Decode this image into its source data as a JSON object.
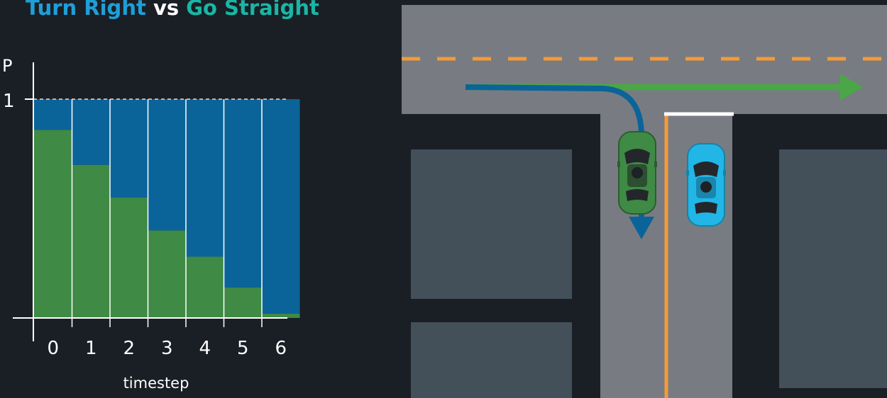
{
  "title": {
    "turn_right": "Turn Right",
    "vs": "vs",
    "go_straight": "Go Straight"
  },
  "colors": {
    "turn_right": "#0b6499",
    "go_straight": "#3f8a45",
    "title_turn_right": "#1f9fd8",
    "title_go_straight": "#19b7a4",
    "background": "#1a1f26",
    "road": "#787c82",
    "block": "#434f59",
    "center_line": "#f59a35",
    "stop_line": "#ffffff",
    "green_car": "#3f8a45",
    "blue_car": "#21b6e6"
  },
  "chart_data": {
    "type": "bar",
    "stacked": true,
    "xlabel": "timestep",
    "ylabel": "P",
    "categories": [
      "0",
      "1",
      "2",
      "3",
      "4",
      "5",
      "6"
    ],
    "yticks": [
      {
        "value": 1,
        "label": "1"
      }
    ],
    "ylim": [
      0,
      1
    ],
    "grid": false,
    "series": [
      {
        "key": "go_straight",
        "values": [
          0.86,
          0.7,
          0.55,
          0.4,
          0.28,
          0.14,
          0.02
        ]
      },
      {
        "key": "turn_right",
        "values": [
          0.14,
          0.3,
          0.45,
          0.6,
          0.72,
          0.86,
          0.98
        ]
      }
    ]
  },
  "scene": {
    "road_orientation": "T-intersection",
    "green_car_path_icon": "arrow-straight-right",
    "blue_car_path_icon": "arrow-turn-right"
  }
}
